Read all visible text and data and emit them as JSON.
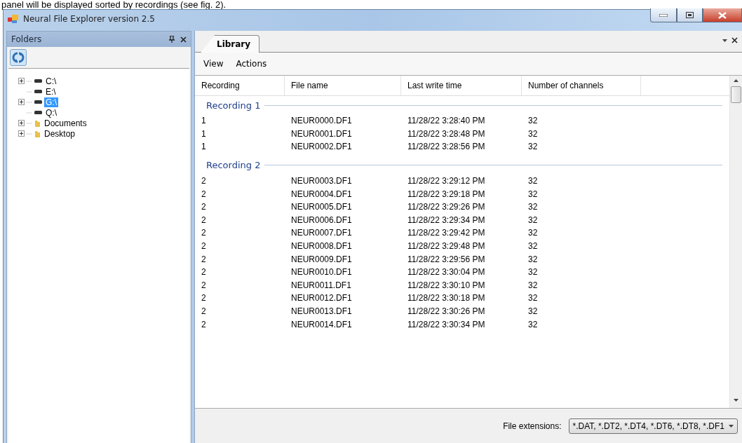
{
  "document_text": "panel will be displayed sorted by recordings (see fig. 2).",
  "window": {
    "title": "Neural File Explorer version 2.5"
  },
  "folders_panel": {
    "title": "Folders",
    "tree": [
      {
        "label": "C:\\",
        "kind": "drive",
        "expandable": true,
        "selected": false
      },
      {
        "label": "E:\\",
        "kind": "drive",
        "expandable": false,
        "selected": false
      },
      {
        "label": "G:\\",
        "kind": "drive",
        "expandable": true,
        "selected": true
      },
      {
        "label": "Q:\\",
        "kind": "drive",
        "expandable": false,
        "selected": false
      },
      {
        "label": "Documents",
        "kind": "folder",
        "expandable": true,
        "selected": false
      },
      {
        "label": "Desktop",
        "kind": "folder",
        "expandable": true,
        "selected": false
      }
    ]
  },
  "tabs": [
    {
      "label": "Library",
      "selected": true
    }
  ],
  "menu": [
    "View",
    "Actions"
  ],
  "table": {
    "columns": [
      "Recording",
      "File name",
      "Last write time",
      "Number of channels"
    ],
    "groups": [
      {
        "title": "Recording 1",
        "rows": [
          [
            "1",
            "NEUR0000.DF1",
            "11/28/22 3:28:40 PM",
            "32"
          ],
          [
            "1",
            "NEUR0001.DF1",
            "11/28/22 3:28:48 PM",
            "32"
          ],
          [
            "1",
            "NEUR0002.DF1",
            "11/28/22 3:28:56 PM",
            "32"
          ]
        ]
      },
      {
        "title": "Recording 2",
        "rows": [
          [
            "2",
            "NEUR0003.DF1",
            "11/28/22 3:29:12 PM",
            "32"
          ],
          [
            "2",
            "NEUR0004.DF1",
            "11/28/22 3:29:18 PM",
            "32"
          ],
          [
            "2",
            "NEUR0005.DF1",
            "11/28/22 3:29:26 PM",
            "32"
          ],
          [
            "2",
            "NEUR0006.DF1",
            "11/28/22 3:29:34 PM",
            "32"
          ],
          [
            "2",
            "NEUR0007.DF1",
            "11/28/22 3:29:42 PM",
            "32"
          ],
          [
            "2",
            "NEUR0008.DF1",
            "11/28/22 3:29:48 PM",
            "32"
          ],
          [
            "2",
            "NEUR0009.DF1",
            "11/28/22 3:29:56 PM",
            "32"
          ],
          [
            "2",
            "NEUR0010.DF1",
            "11/28/22 3:30:04 PM",
            "32"
          ],
          [
            "2",
            "NEUR0011.DF1",
            "11/28/22 3:30:10 PM",
            "32"
          ],
          [
            "2",
            "NEUR0012.DF1",
            "11/28/22 3:30:18 PM",
            "32"
          ],
          [
            "2",
            "NEUR0013.DF1",
            "11/28/22 3:30:26 PM",
            "32"
          ],
          [
            "2",
            "NEUR0014.DF1",
            "11/28/22 3:30:34 PM",
            "32"
          ]
        ]
      }
    ]
  },
  "file_extensions": {
    "label": "File extensions:",
    "value": "*.DAT, *.DT2, *.DT4, *.DT6, *.DT8, *.DF1"
  }
}
